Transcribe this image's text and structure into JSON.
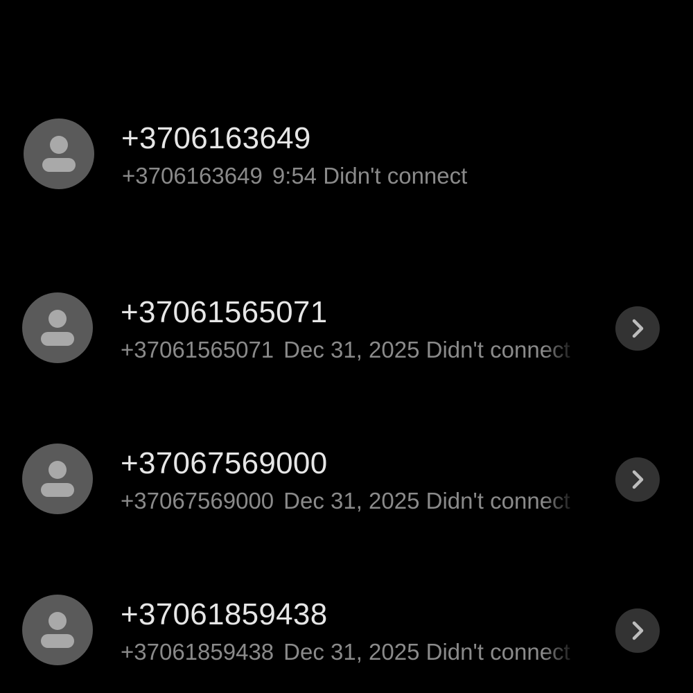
{
  "calls": [
    {
      "name": "+3706163649",
      "number": "+3706163649",
      "time": "9:54",
      "status": "Didn't connect",
      "has_details_button": false,
      "avatar_icon": "person-icon"
    },
    {
      "name": "+37061565071",
      "number": "+37061565071",
      "time": "Dec 31, 2025",
      "status": "Didn't connect",
      "has_details_button": true,
      "avatar_icon": "person-icon",
      "details_icon": "chevron-right-icon"
    },
    {
      "name": "+37067569000",
      "number": "+37067569000",
      "time": "Dec 31, 2025",
      "status": "Didn't connect",
      "has_details_button": true,
      "avatar_icon": "person-icon",
      "details_icon": "chevron-right-icon"
    },
    {
      "name": "+37061859438",
      "number": "+37061859438",
      "time": "Dec 31, 2025",
      "status": "Didn't connect",
      "has_details_button": true,
      "avatar_icon": "person-icon",
      "details_icon": "chevron-right-icon"
    }
  ],
  "colors": {
    "background": "#000000",
    "avatar_bg": "#5a5a5a",
    "avatar_glyph": "#a9a9a9",
    "primary_text": "#e6e6e6",
    "secondary_text": "#8a8a8a",
    "details_button_bg": "#333333",
    "details_chevron": "#bdbdbd"
  }
}
